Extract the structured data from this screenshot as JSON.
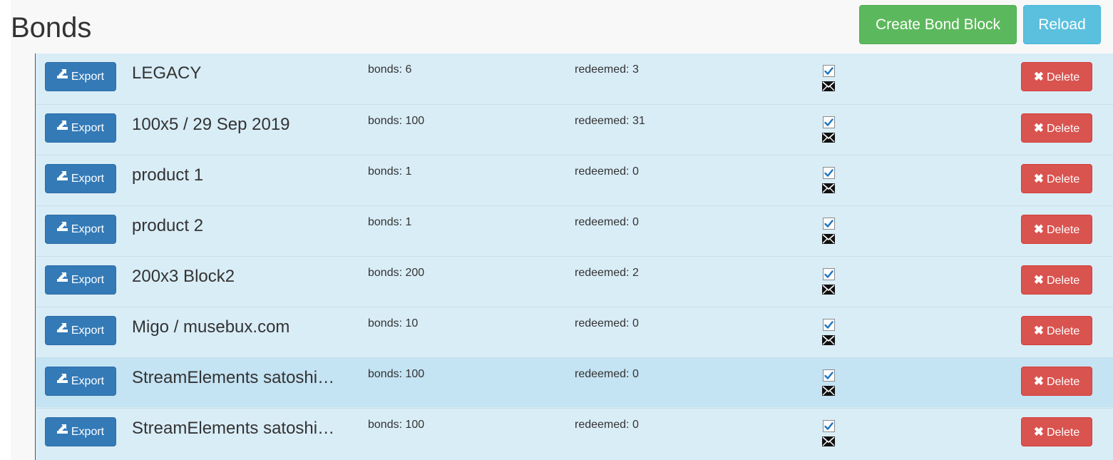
{
  "header": {
    "title": "Bonds",
    "create_label": "Create Bond Block",
    "reload_label": "Reload"
  },
  "colors": {
    "success": "#5cb85c",
    "info": "#5bc0de",
    "primary": "#337ab7",
    "danger": "#d9534f",
    "row_bg": "#d9edf7",
    "row_active_bg": "#c4e3f3"
  },
  "row_labels": {
    "export": "Export",
    "delete": "Delete"
  },
  "icons": {
    "export": "export-icon",
    "delete": "close-icon",
    "check": "checkbox-checked-icon",
    "mail": "envelope-icon"
  },
  "rows": [
    {
      "name": "LEGACY",
      "bonds": "bonds: 6",
      "redeemed": "redeemed: 3",
      "checked": true
    },
    {
      "name": "100x5 / 29 Sep 2019",
      "bonds": "bonds: 100",
      "redeemed": "redeemed: 31",
      "checked": true
    },
    {
      "name": "product 1",
      "bonds": "bonds: 1",
      "redeemed": "redeemed: 0",
      "checked": true
    },
    {
      "name": "product 2",
      "bonds": "bonds: 1",
      "redeemed": "redeemed: 0",
      "checked": true
    },
    {
      "name": "200x3 Block2",
      "bonds": "bonds: 200",
      "redeemed": "redeemed: 2",
      "checked": true
    },
    {
      "name": "Migo / musebux.com",
      "bonds": "bonds: 10",
      "redeemed": "redeemed: 0",
      "checked": true
    },
    {
      "name": "StreamElements satoshi…",
      "bonds": "bonds: 100",
      "redeemed": "redeemed: 0",
      "checked": true,
      "highlighted": true
    },
    {
      "name": "StreamElements satoshi…",
      "bonds": "bonds: 100",
      "redeemed": "redeemed: 0",
      "checked": true
    }
  ]
}
